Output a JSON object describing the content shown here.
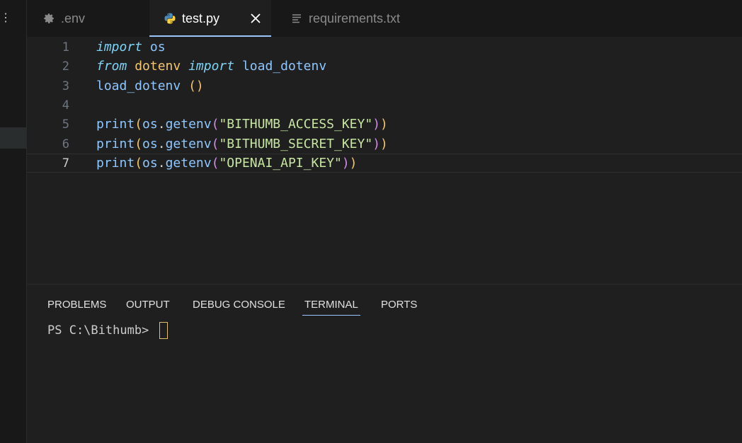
{
  "side": {
    "more_glyph": "⋮"
  },
  "tabs": [
    {
      "label": ".env",
      "icon": "gear-icon"
    },
    {
      "label": "test.py",
      "icon": "python-icon"
    },
    {
      "label": "requirements.txt",
      "icon": "lines-icon"
    }
  ],
  "editor": {
    "line_numbers": [
      "1",
      "2",
      "3",
      "4",
      "5",
      "6",
      "7"
    ],
    "current_line": 7,
    "tokens": {
      "l1_import": "import",
      "l1_os": "os",
      "l2_from": "from",
      "l2_dotenv": "dotenv",
      "l2_import": "import",
      "l2_load": "load_dotenv",
      "l3_call": "load_dotenv",
      "l3_paren": "()",
      "print": "print",
      "open": "(",
      "os": "os",
      "dot": ".",
      "getenv": "getenv",
      "close": ")",
      "l5_str": "\"BITHUMB_ACCESS_KEY\"",
      "l6_str": "\"BITHUMB_SECRET_KEY\"",
      "l7_str": "\"OPENAI_API_KEY\""
    }
  },
  "panel": {
    "tabs": [
      "PROBLEMS",
      "OUTPUT",
      "DEBUG CONSOLE",
      "TERMINAL",
      "PORTS"
    ],
    "active_tab": "TERMINAL",
    "prompt": "PS C:\\Bithumb> "
  },
  "colors": {
    "background": "#1f1f1f",
    "tab_underline": "#9bc6ff",
    "keyword": "#7dd3f5",
    "string": "#c7e6a1",
    "bracket_yellow": "#f5c66c",
    "bracket_purple": "#d38de8"
  }
}
